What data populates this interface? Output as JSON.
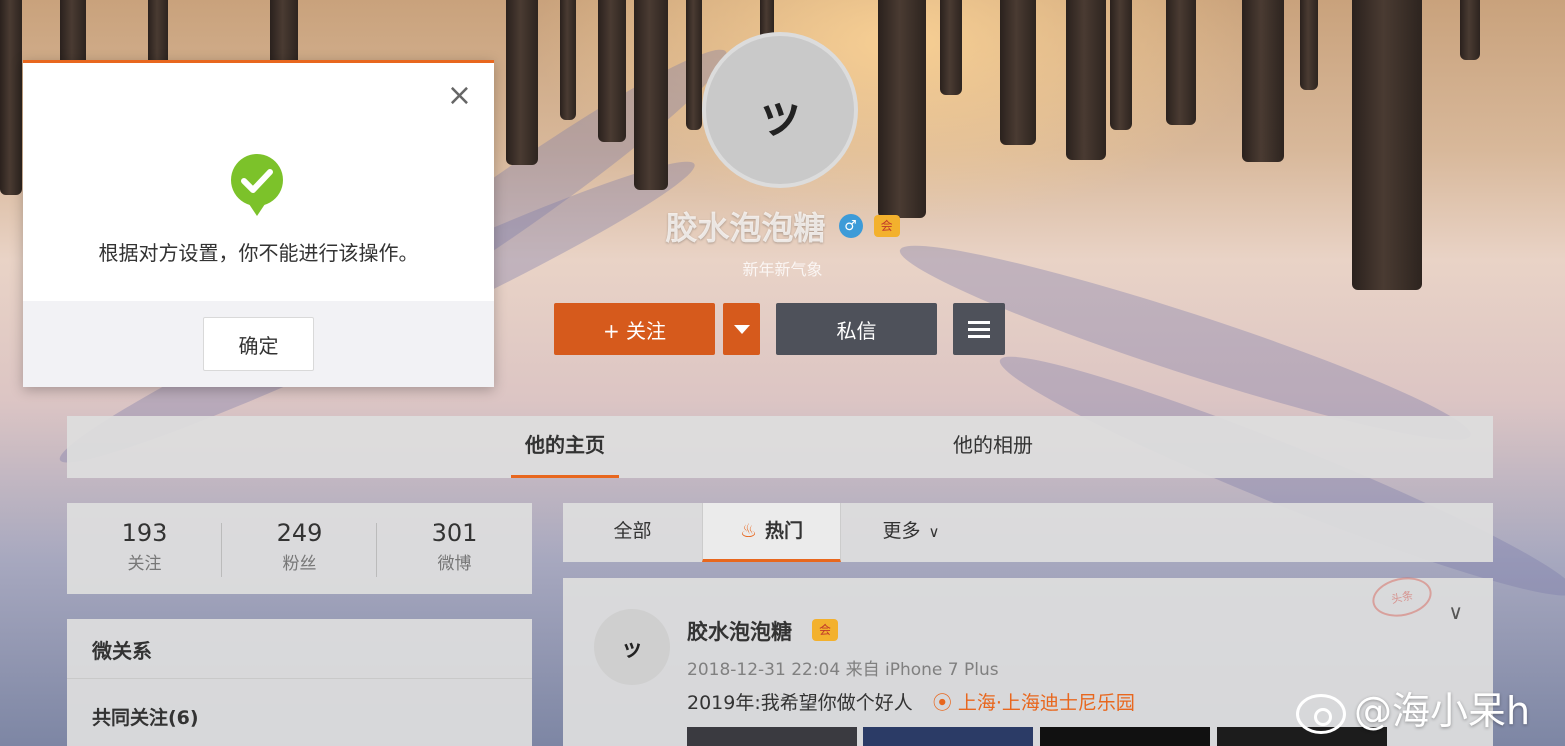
{
  "profile": {
    "avatar_char": "ッ",
    "nickname": "胶水泡泡糖",
    "gender_symbol": "♂",
    "vip_badge": "会",
    "slogan": "新年新气象",
    "follow_label": "+ 关注",
    "message_label": "私信"
  },
  "tabs": {
    "home": "他的主页",
    "album": "他的相册"
  },
  "stats": [
    {
      "num": "193",
      "label": "关注"
    },
    {
      "num": "249",
      "label": "粉丝"
    },
    {
      "num": "301",
      "label": "微博"
    }
  ],
  "relations": {
    "title": "微关系",
    "common_follow": "共同关注(6)"
  },
  "feed_tabs": {
    "all": "全部",
    "hot": "热门",
    "more": "更多"
  },
  "post": {
    "avatar_char": "ッ",
    "author": "胶水泡泡糖",
    "meta": "2018-12-31 22:04 来自 iPhone 7 Plus",
    "text": "2019年:我希望你做个好人",
    "location": "上海·上海迪士尼乐园",
    "stamp": "头条"
  },
  "modal": {
    "message": "根据对方设置，你不能进行该操作。",
    "ok_label": "确定",
    "close_symbol": "×"
  },
  "watermark": "@海小呆h",
  "colors": {
    "accent": "#e8671e",
    "follow_button": "#d65a1c",
    "dark_button": "#4e515a",
    "success": "#7cc22a"
  }
}
